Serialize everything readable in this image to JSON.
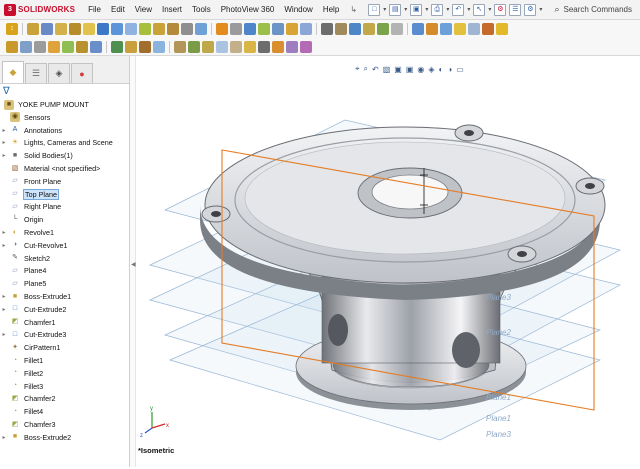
{
  "app": {
    "brand": "SOLIDWORKS",
    "menu": [
      "File",
      "Edit",
      "View",
      "Insert",
      "Tools",
      "PhotoView 360",
      "Window",
      "Help"
    ],
    "search_placeholder": "Search Commands"
  },
  "tree": {
    "root": "YOKE PUMP MOUNT",
    "items": [
      {
        "label": "Sensors",
        "icon": "sensors-icon",
        "expander": false
      },
      {
        "label": "Annotations",
        "icon": "annotations-icon",
        "expander": true
      },
      {
        "label": "Lights, Cameras and Scene",
        "icon": "lights-icon",
        "expander": true
      },
      {
        "label": "Solid Bodies(1)",
        "icon": "solid-bodies-icon",
        "expander": true
      },
      {
        "label": "Material <not specified>",
        "icon": "material-icon",
        "expander": false
      },
      {
        "label": "Front Plane",
        "icon": "plane-icon",
        "expander": false
      },
      {
        "label": "Top Plane",
        "icon": "plane-icon",
        "expander": false,
        "selected": true
      },
      {
        "label": "Right Plane",
        "icon": "plane-icon",
        "expander": false
      },
      {
        "label": "Origin",
        "icon": "origin-icon",
        "expander": false
      },
      {
        "label": "Revolve1",
        "icon": "revolve-icon",
        "expander": true
      },
      {
        "label": "Cut-Revolve1",
        "icon": "cut-revolve-icon",
        "expander": true
      },
      {
        "label": "Sketch2",
        "icon": "sketch-icon",
        "expander": false
      },
      {
        "label": "Plane4",
        "icon": "plane-icon",
        "expander": false
      },
      {
        "label": "Plane5",
        "icon": "plane-icon",
        "expander": false
      },
      {
        "label": "Boss-Extrude1",
        "icon": "boss-extrude-icon",
        "expander": true
      },
      {
        "label": "Cut-Extrude2",
        "icon": "cut-extrude-icon",
        "expander": true
      },
      {
        "label": "Chamfer1",
        "icon": "chamfer-icon",
        "expander": false
      },
      {
        "label": "Cut-Extrude3",
        "icon": "cut-extrude-icon",
        "expander": true
      },
      {
        "label": "CirPattern1",
        "icon": "circular-pattern-icon",
        "expander": false
      },
      {
        "label": "Fillet1",
        "icon": "fillet-icon",
        "expander": false
      },
      {
        "label": "Fillet2",
        "icon": "fillet-icon",
        "expander": false
      },
      {
        "label": "Fillet3",
        "icon": "fillet-icon",
        "expander": false
      },
      {
        "label": "Chamfer2",
        "icon": "chamfer-icon",
        "expander": false
      },
      {
        "label": "Fillet4",
        "icon": "fillet-icon",
        "expander": false
      },
      {
        "label": "Chamfer3",
        "icon": "chamfer-icon",
        "expander": false
      },
      {
        "label": "Boss-Extrude2",
        "icon": "boss-extrude-icon",
        "expander": true
      }
    ]
  },
  "viewport": {
    "view_name": "*Isometric",
    "plane_labels": [
      "Plane3",
      "Plane2",
      "Plane1",
      "Plane1",
      "Plane3"
    ],
    "triad": {
      "x": "x",
      "y": "y",
      "z": "z"
    }
  },
  "colors": {
    "brand_red": "#c8102e",
    "selection": "#cde4fb",
    "plane_edge": "#e57c24",
    "plane_fill": "#b9cfe6"
  }
}
